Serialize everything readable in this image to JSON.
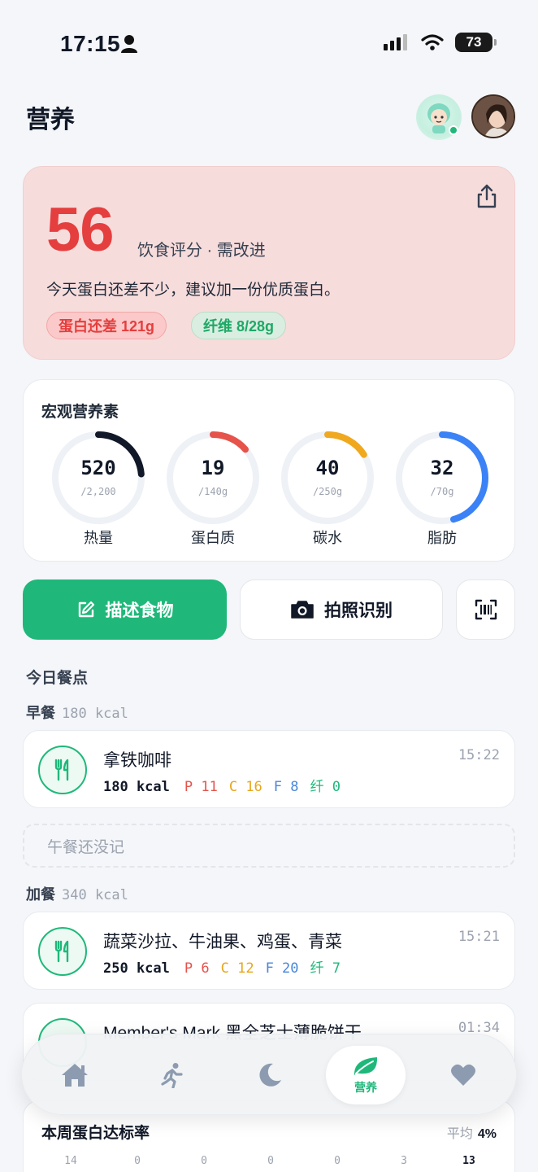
{
  "status_bar": {
    "time": "17:15",
    "battery": "73"
  },
  "header": {
    "title": "营养"
  },
  "score": {
    "value": "56",
    "label": "饮食评分 · 需改进",
    "description": "今天蛋白还差不少，建议加一份优质蛋白。",
    "tags": [
      "蛋白还差 121g",
      "纤维 8/28g"
    ]
  },
  "macros": {
    "title": "宏观营养素",
    "items": [
      {
        "value": "520",
        "target": "/2,200",
        "label": "热量",
        "progress": 0.236,
        "color": "#111827"
      },
      {
        "value": "19",
        "target": "/140g",
        "label": "蛋白质",
        "progress": 0.136,
        "color": "#e5534b"
      },
      {
        "value": "40",
        "target": "/250g",
        "label": "碳水",
        "progress": 0.16,
        "color": "#f0a81e"
      },
      {
        "value": "32",
        "target": "/70g",
        "label": "脂肪",
        "progress": 0.457,
        "color": "#3b82f6"
      }
    ]
  },
  "actions": {
    "describe": "描述食物",
    "photo": "拍照识别"
  },
  "today": {
    "title": "今日餐点",
    "breakfast": {
      "name": "早餐",
      "kcal": "180 kcal",
      "item": {
        "name": "拿铁咖啡",
        "kcal": "180 kcal",
        "p": "P 11",
        "c": "C 16",
        "f": "F 8",
        "fiber": "纤 0",
        "time": "15:22"
      }
    },
    "lunch_empty": "午餐还没记",
    "snack": {
      "name": "加餐",
      "kcal": "340 kcal",
      "item": {
        "name": "蔬菜沙拉、牛油果、鸡蛋、青菜",
        "kcal": "250 kcal",
        "p": "P 6",
        "c": "C 12",
        "f": "F 20",
        "fiber": "纤 7",
        "time": "15:21"
      },
      "item2": {
        "name": "Member's Mark 黑全芝士薄脆饼干",
        "time": "01:34"
      }
    }
  },
  "weekly": {
    "title": "本周蛋白达标率",
    "avg_label": "平均",
    "avg_value": "4%",
    "days": [
      "14",
      "0",
      "0",
      "0",
      "0",
      "3",
      "13"
    ]
  },
  "tabbar": {
    "active_label": "营养"
  }
}
